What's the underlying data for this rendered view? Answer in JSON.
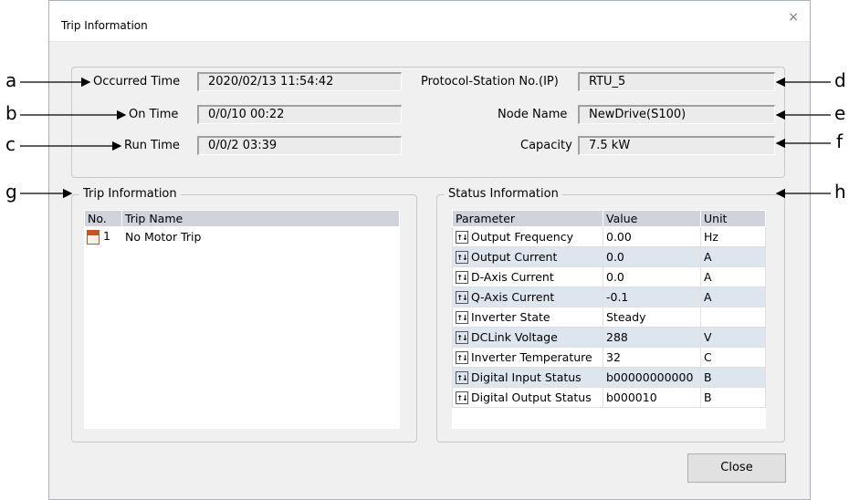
{
  "dialog": {
    "title": "Trip Information",
    "close_glyph": "×",
    "close_button": "Close"
  },
  "top": {
    "occurred_time_label": "Occurred Time",
    "occurred_time": "2020/02/13 11:54:42",
    "on_time_label": "On Time",
    "on_time": "0/0/10 00:22",
    "run_time_label": "Run Time",
    "run_time": "0/0/2 03:39",
    "station_label": "Protocol-Station No.(IP)",
    "station": "RTU_5",
    "node_label": "Node Name",
    "node": "NewDrive(S100)",
    "capacity_label": "Capacity",
    "capacity": "7.5 kW"
  },
  "trip": {
    "legend": "Trip Information",
    "columns": [
      "No.",
      "Trip Name"
    ],
    "rows": [
      {
        "no": "1",
        "name": "No Motor Trip"
      }
    ],
    "icon": "trip-icon"
  },
  "status": {
    "legend": "Status Information",
    "columns": [
      "Parameter",
      "Value",
      "Unit"
    ],
    "icon": "parameter-icon",
    "rows": [
      {
        "param": "Output Frequency",
        "value": "0.00",
        "unit": "Hz"
      },
      {
        "param": "Output Current",
        "value": "0.0",
        "unit": "A"
      },
      {
        "param": "D-Axis Current",
        "value": "0.0",
        "unit": "A"
      },
      {
        "param": "Q-Axis Current",
        "value": "-0.1",
        "unit": "A"
      },
      {
        "param": "Inverter State",
        "value": "Steady",
        "unit": ""
      },
      {
        "param": "DCLink Voltage",
        "value": "288",
        "unit": "V"
      },
      {
        "param": "Inverter Temperature",
        "value": "32",
        "unit": "C"
      },
      {
        "param": "Digital Input Status",
        "value": "b00000000000",
        "unit": "B"
      },
      {
        "param": "Digital Output Status",
        "value": "b000010",
        "unit": "B"
      }
    ]
  },
  "callouts": {
    "a": "a",
    "b": "b",
    "c": "c",
    "d": "d",
    "e": "e",
    "f": "f",
    "g": "g",
    "h": "h"
  }
}
